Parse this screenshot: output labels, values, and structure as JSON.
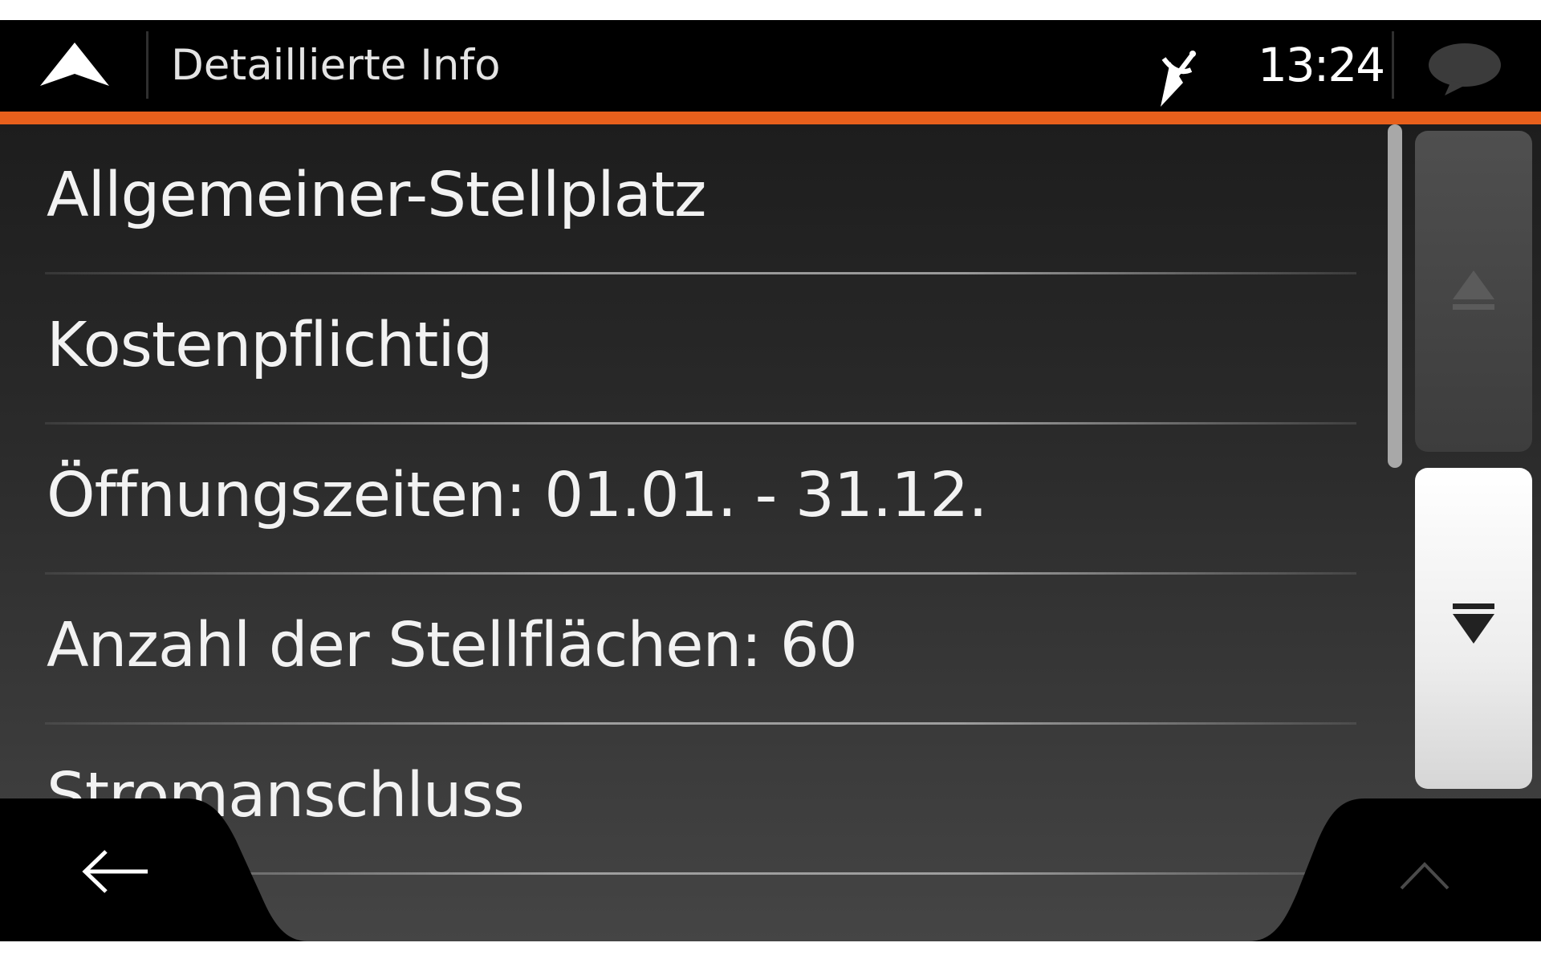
{
  "header": {
    "title": "Detaillierte Info",
    "time": "13:24"
  },
  "details": {
    "items": [
      {
        "label": "Allgemeiner-Stellplatz"
      },
      {
        "label": "Kostenpflichtig"
      },
      {
        "label": "Öffnungszeiten: 01.01. - 31.12."
      },
      {
        "label": "Anzahl der Stellflächen: 60"
      },
      {
        "label": "Stromanschluss"
      }
    ]
  },
  "icons": {
    "nav": "navigation-arrow-icon",
    "gps": "gps-signal-off-icon",
    "message": "message-bubble-icon",
    "scroll_up": "scroll-up-arrow-icon",
    "scroll_down": "scroll-down-arrow-icon",
    "back": "back-arrow-icon",
    "expand": "chevron-up-icon"
  },
  "colors": {
    "accent": "#e8601c",
    "background": "#000000",
    "text": "#f2f2f2"
  },
  "scroll": {
    "position_fraction": 0.0,
    "visible_fraction": 0.55
  }
}
